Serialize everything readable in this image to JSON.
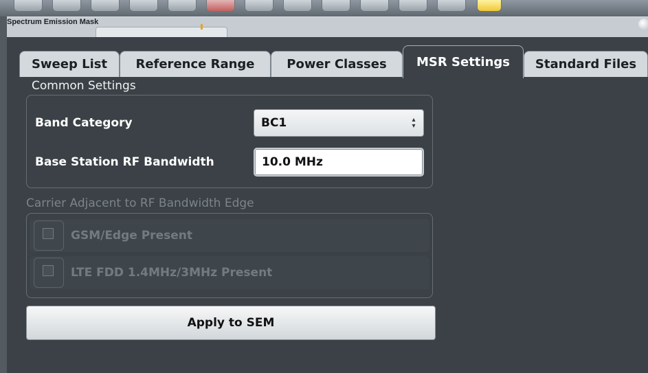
{
  "background_window": {
    "title": "Spectrum Emission Mask"
  },
  "dialog": {
    "tabs": [
      {
        "label": "Sweep List"
      },
      {
        "label": "Reference Range"
      },
      {
        "label": "Power Classes"
      },
      {
        "label": "MSR Settings",
        "active": true
      },
      {
        "label": "Standard Files"
      }
    ],
    "common_settings": {
      "title": "Common Settings",
      "band_category_label": "Band Category",
      "band_category_value": "BC1",
      "bandwidth_label": "Base Station RF Bandwidth",
      "bandwidth_value": "10.0 MHz"
    },
    "carrier_adjacent": {
      "title": "Carrier Adjacent to RF Bandwidth Edge",
      "gsm_label": "GSM/Edge Present",
      "gsm_checked": false,
      "lte_label": "LTE FDD 1.4MHz/3MHz Present",
      "lte_checked": false
    },
    "apply_label": "Apply to SEM"
  },
  "colors": {
    "dialog_bg": "#3b4146",
    "tab_inactive_bg": "#d4d9dd",
    "disabled_text": "#737b82"
  }
}
